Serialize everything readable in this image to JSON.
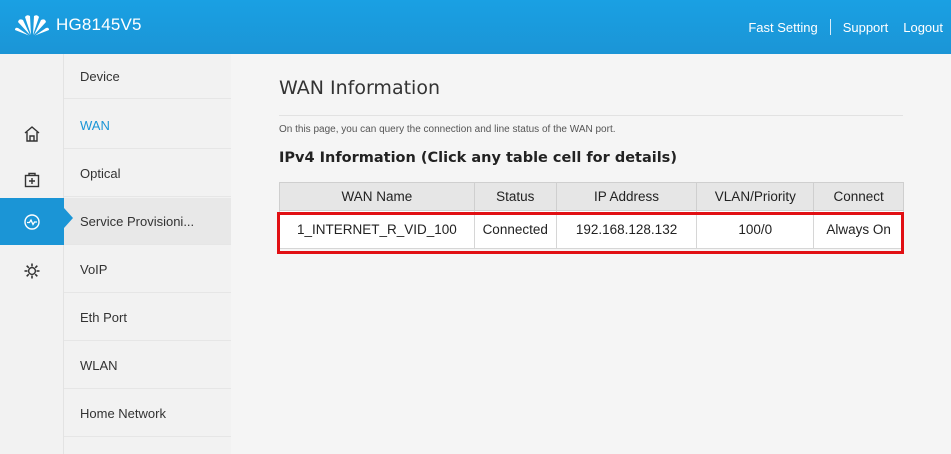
{
  "header": {
    "brand": "HG8145V5",
    "nav": {
      "fast_setting": "Fast Setting",
      "support": "Support",
      "logout": "Logout"
    },
    "colors": {
      "bar": "#1b95d6",
      "text": "#ffffff"
    }
  },
  "rail": {
    "icons": [
      "home-icon",
      "plus-box-icon",
      "service-provisioning-icon",
      "gear-icon"
    ],
    "active_icon": "service-provisioning-icon",
    "active_color": "#1b95d6"
  },
  "menu": {
    "items": [
      {
        "label": "Device"
      },
      {
        "label": "WAN",
        "current": true
      },
      {
        "label": "Optical"
      },
      {
        "label": "Service Provisioni..."
      },
      {
        "label": "VoIP"
      },
      {
        "label": "Eth Port"
      },
      {
        "label": "WLAN"
      },
      {
        "label": "Home Network"
      }
    ]
  },
  "page": {
    "title": "WAN Information",
    "description": "On this page, you can query the connection and line status of the WAN port.",
    "section_title": "IPv4 Information (Click any table cell for details)"
  },
  "table": {
    "headers": [
      "WAN Name",
      "Status",
      "IP Address",
      "VLAN/Priority",
      "Connect"
    ],
    "rows": [
      [
        "1_INTERNET_R_VID_100",
        "Connected",
        "192.168.128.132",
        "100/0",
        "Always On"
      ]
    ],
    "highlight_color": "#e10f13"
  }
}
